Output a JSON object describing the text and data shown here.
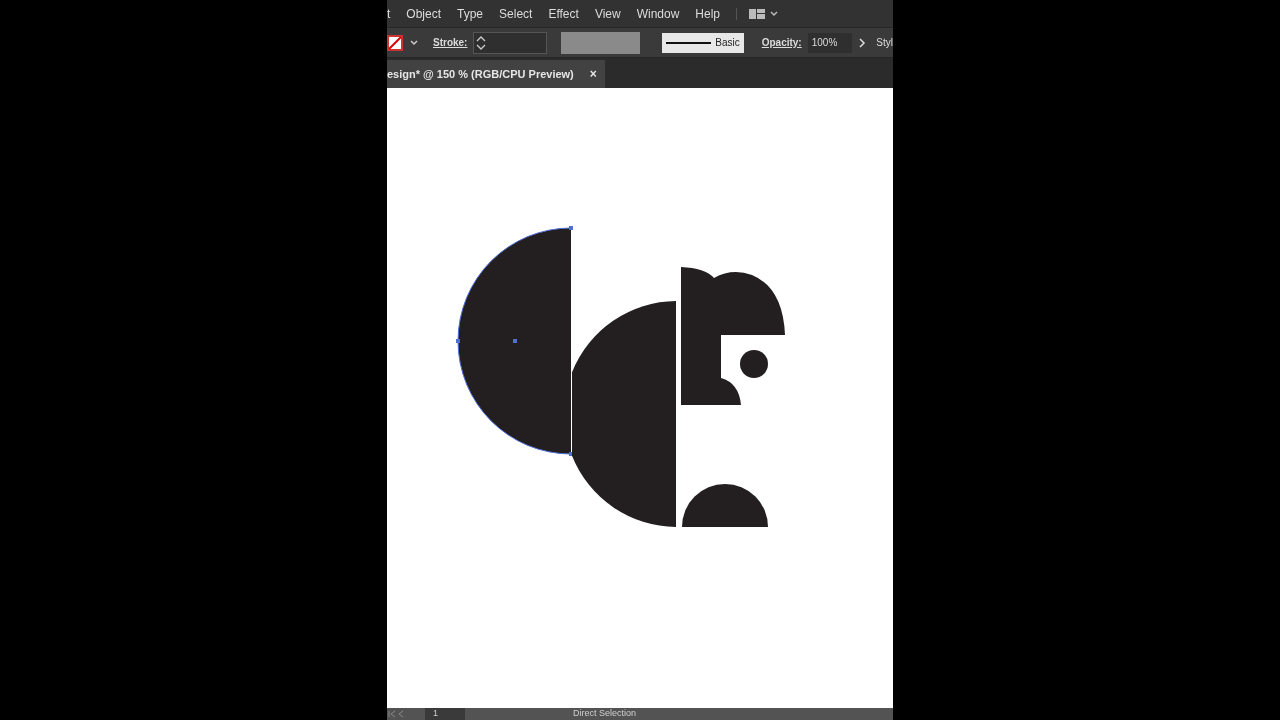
{
  "menu_bar": {
    "items": [
      "t",
      "Object",
      "Type",
      "Select",
      "Effect",
      "View",
      "Window",
      "Help"
    ]
  },
  "control_bar": {
    "stroke_label": "Stroke:",
    "brush": "Basic",
    "opacity_label": "Opacity:",
    "opacity": "100%",
    "style_label": "Styl"
  },
  "document_tab": {
    "title": "esign* @ 150 % (RGB/CPU Preview)",
    "close": "×",
    "selected": true
  },
  "canvas": {
    "shapes": [
      {
        "kind": "half-circle-left",
        "selected": true
      },
      {
        "kind": "half-circle-middle",
        "selected": false
      },
      {
        "kind": "head",
        "selected": false
      },
      {
        "kind": "half-circle-bottom",
        "selected": false
      },
      {
        "kind": "dot",
        "selected": false
      }
    ]
  },
  "status_bar": {
    "page": "1",
    "tool": "Direct Selection"
  }
}
